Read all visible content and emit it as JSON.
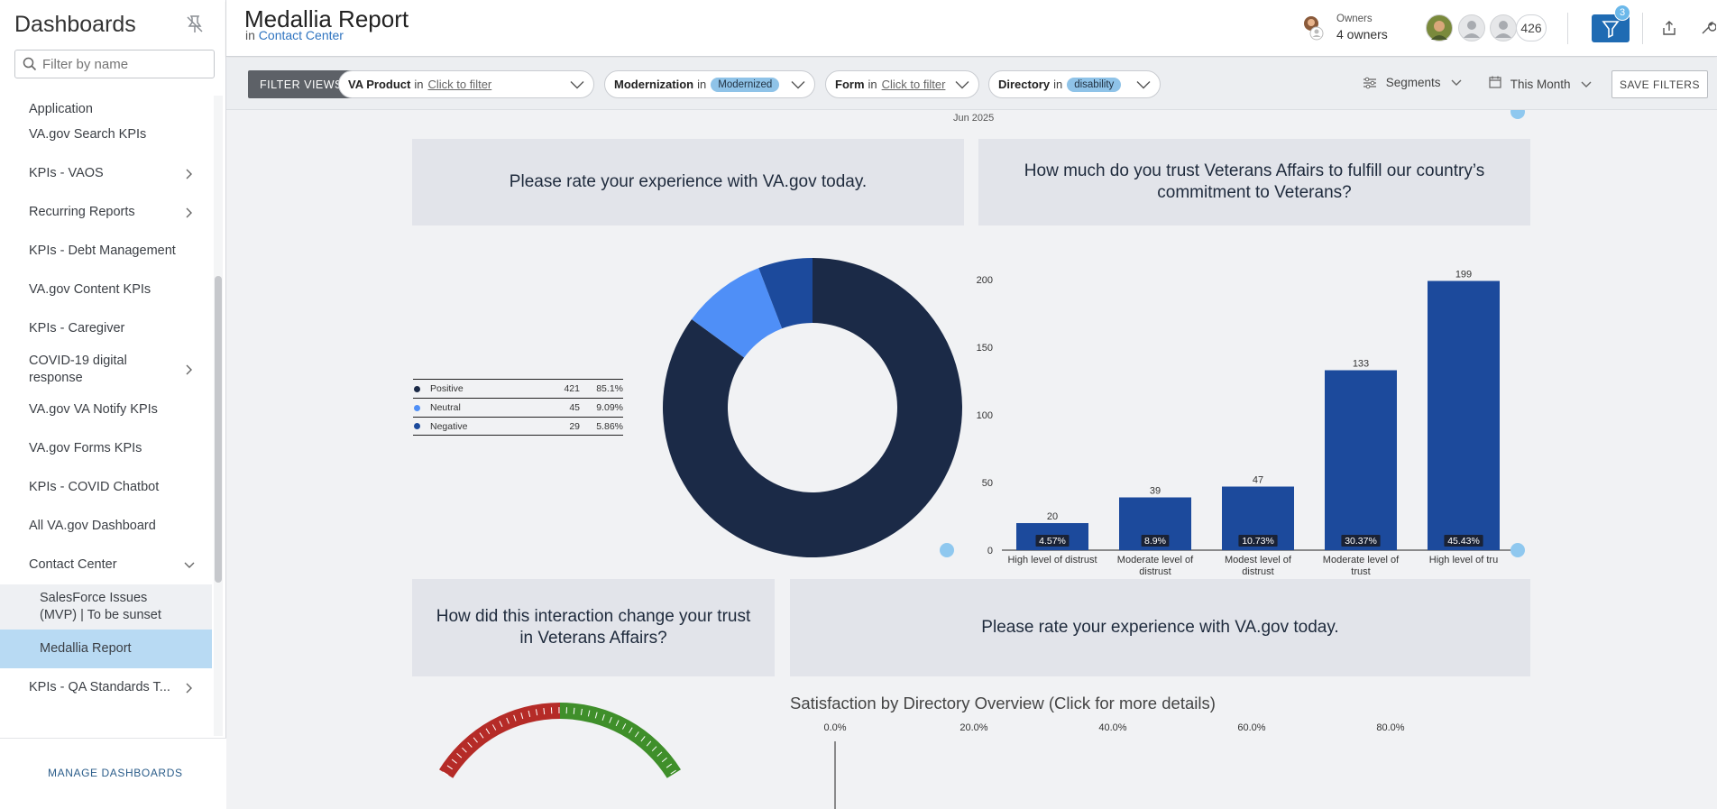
{
  "sidebar": {
    "title": "Dashboards",
    "filter_placeholder": "Filter by name",
    "items": [
      {
        "label": "KPIs - Health Care Application",
        "chevron": false
      },
      {
        "label": "VA.gov Search KPIs",
        "chevron": false
      },
      {
        "label": "KPIs - VAOS",
        "chevron": true
      },
      {
        "label": "Recurring Reports",
        "chevron": true
      },
      {
        "label": "KPIs - Debt Management",
        "chevron": false
      },
      {
        "label": "VA.gov Content KPIs",
        "chevron": false
      },
      {
        "label": "KPIs - Caregiver",
        "chevron": false
      },
      {
        "label": "COVID-19 digital response",
        "chevron": true
      },
      {
        "label": "VA.gov VA Notify KPIs",
        "chevron": false
      },
      {
        "label": "VA.gov Forms KPIs",
        "chevron": false
      },
      {
        "label": "KPIs - COVID Chatbot",
        "chevron": false
      },
      {
        "label": "All VA.gov Dashboard",
        "chevron": false
      },
      {
        "label": "Contact Center",
        "chevron": "down"
      },
      {
        "label": "SalesForce Issues (MVP) | To be sunset",
        "child": true
      },
      {
        "label": "Medallia Report",
        "child": true,
        "active": true
      },
      {
        "label": "KPIs - QA Standards T...",
        "chevron": true
      }
    ],
    "manage_label": "MANAGE DASHBOARDS"
  },
  "header": {
    "title": "Medallia Report",
    "sub_prefix": "in",
    "sub_link": "Contact Center",
    "owners_label": "Owners",
    "owners_value": "4 owners",
    "viewer_count": "426",
    "filter_badge": "3"
  },
  "filterbar": {
    "filter_views": "FILTER VIEWS",
    "chips": [
      {
        "field": "VA Product",
        "op": "in",
        "value": "Click to filter",
        "tag": false
      },
      {
        "field": "Modernization",
        "op": "in",
        "value": "Modernized",
        "tag": true
      },
      {
        "field": "Form",
        "op": "in",
        "value": "Click to filter",
        "tag": false
      },
      {
        "field": "Directory",
        "op": "in",
        "value": "disability",
        "tag": true
      }
    ],
    "segments": "Segments",
    "date_range": "This Month",
    "save": "SAVE FILTERS"
  },
  "content": {
    "date_label": "Jun 2025",
    "q1": "Please rate your experience with VA.gov today.",
    "q2": "How much do you trust Veterans Affairs to fulfill our country’s commitment to Veterans?",
    "q3": "How did this interaction change your trust in Veterans Affairs?",
    "q4": "Please rate your experience with VA.gov today.",
    "subtitle2": "Satisfaction by Directory Overview (Click for more details)"
  },
  "colors": {
    "positive": "#1b2a47",
    "neutral": "#4f8ff7",
    "negative": "#1c4a9c",
    "bar": "#1c4a9c",
    "gauge_red": "#b52b27",
    "gauge_green": "#3f8f2a"
  },
  "chart_data": [
    {
      "type": "pie",
      "title": "Please rate your experience with VA.gov today.",
      "categories": [
        "Positive",
        "Neutral",
        "Negative"
      ],
      "values": [
        421,
        45,
        29
      ],
      "percents": [
        "85.1%",
        "9.09%",
        "5.86%"
      ]
    },
    {
      "type": "bar",
      "title": "How much do you trust Veterans Affairs to fulfill our country’s commitment to Veterans?",
      "categories": [
        "High level of distrust",
        "Moderate level of distrust",
        "Modest level of distrust",
        "Moderate level of trust",
        "High level of trust"
      ],
      "category_lines": [
        [
          "High level of distrust"
        ],
        [
          "Moderate level of",
          "distrust"
        ],
        [
          "Modest level of",
          "distrust"
        ],
        [
          "Moderate level of",
          "trust"
        ],
        [
          "High level of tru"
        ]
      ],
      "values": [
        20,
        39,
        47,
        133,
        199
      ],
      "percents": [
        "4.57%",
        "8.9%",
        "10.73%",
        "30.37%",
        "45.43%"
      ],
      "yticks": [
        0,
        50,
        100,
        150,
        200
      ],
      "ylim": [
        0,
        200
      ]
    },
    {
      "type": "bar",
      "title": "Satisfaction by Directory Overview (Click for more details)",
      "xticks": [
        "0.0%",
        "20.0%",
        "40.0%",
        "60.0%",
        "80.0%"
      ],
      "values": []
    }
  ]
}
